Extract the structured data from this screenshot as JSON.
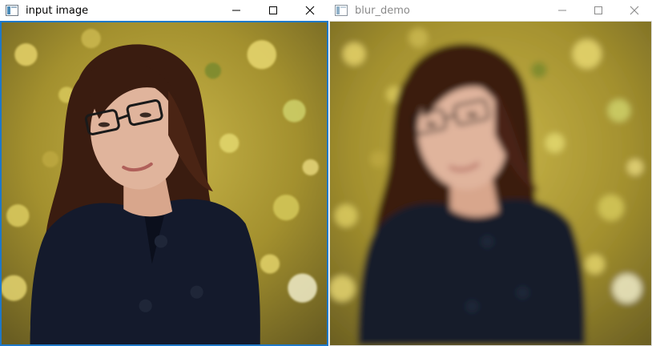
{
  "windows": [
    {
      "title": "input image",
      "active": true,
      "controls": {
        "minimize_icon": "minimize-icon",
        "maximize_icon": "maximize-icon",
        "close_icon": "close-icon"
      },
      "image": {
        "content": "photo",
        "blurred": false
      }
    },
    {
      "title": "blur_demo",
      "active": false,
      "controls": {
        "minimize_icon": "minimize-icon",
        "maximize_icon": "maximize-icon",
        "close_icon": "close-icon"
      },
      "image": {
        "content": "photo",
        "blurred": true
      }
    }
  ],
  "colors": {
    "active_border": "#1e78c8",
    "inactive_border": "#dcdcdc",
    "inactive_title": "#8a8a8a",
    "background_foliage": "#b9a23a",
    "coat": "#141a2c",
    "hair": "#3a1c10",
    "skin": "#e0b49c"
  }
}
